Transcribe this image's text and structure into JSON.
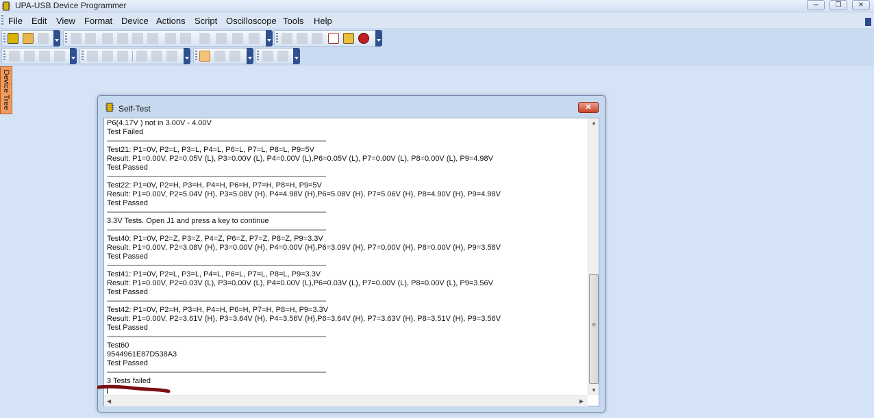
{
  "window": {
    "title": "UPA-USB Device Programmer",
    "buttons": [
      "─",
      "❐",
      "✕"
    ]
  },
  "menu": [
    "File",
    "Edit",
    "View",
    "Format",
    "Device",
    "Actions",
    "Script",
    "Oscilloscope",
    "Tools",
    "Help"
  ],
  "side_tab": "Device Tree",
  "dialog": {
    "title": "Self-Test",
    "close_label": "✕",
    "lines": [
      "P6(4.17V ) not in 3.00V - 4.00V",
      "Test Failed",
      "------------------------------------------------------------------------------------------------------------------------",
      "Test21: P1=0V, P2=L, P3=L, P4=L, P6=L, P7=L, P8=L, P9=5V",
      "Result: P1=0.00V, P2=0.05V (L), P3=0.00V (L), P4=0.00V (L),P6=0.05V (L), P7=0.00V (L), P8=0.00V (L), P9=4.98V",
      "Test Passed",
      "------------------------------------------------------------------------------------------------------------------------",
      "Test22: P1=0V, P2=H, P3=H, P4=H, P6=H, P7=H, P8=H, P9=5V",
      "Result: P1=0.00V, P2=5.04V (H), P3=5.08V (H), P4=4.98V (H),P6=5.08V (H), P7=5.06V (H), P8=4.90V (H), P9=4.98V",
      "Test Passed",
      "------------------------------------------------------------------------------------------------------------------------",
      "3.3V Tests. Open J1 and press a key to continue",
      "------------------------------------------------------------------------------------------------------------------------",
      "Test40: P1=0V, P2=Z, P3=Z, P4=Z, P6=Z, P7=Z, P8=Z, P9=3.3V",
      "Result: P1=0.00V, P2=3.08V (H), P3=0.00V (H), P4=0.00V (H),P6=3.09V (H), P7=0.00V (H), P8=0.00V (H), P9=3.58V",
      "Test Passed",
      "------------------------------------------------------------------------------------------------------------------------",
      "Test41: P1=0V, P2=L, P3=L, P4=L, P6=L, P7=L, P8=L, P9=3.3V",
      "Result: P1=0.00V, P2=0.03V (L), P3=0.00V (L), P4=0.00V (L),P6=0.03V (L), P7=0.00V (L), P8=0.00V (L), P9=3.56V",
      "Test Passed",
      "------------------------------------------------------------------------------------------------------------------------",
      "Test42: P1=0V, P2=H, P3=H, P4=H, P6=H, P7=H, P8=H, P9=3.3V",
      "Result: P1=0.00V, P2=3.61V (H), P3=3.64V (H), P4=3.56V (H),P6=3.64V (H), P7=3.63V (H), P8=3.51V (H), P9=3.56V",
      "Test Passed",
      "------------------------------------------------------------------------------------------------------------------------",
      "Test60",
      "9544961E87D538A3",
      "Test Passed",
      "------------------------------------------------------------------------------------------------------------------------",
      "3 Tests failed"
    ]
  },
  "colors": {
    "close_red": "#c9442b",
    "side_tab_orange": "#f29b5e",
    "marker": "#7a0f12"
  }
}
